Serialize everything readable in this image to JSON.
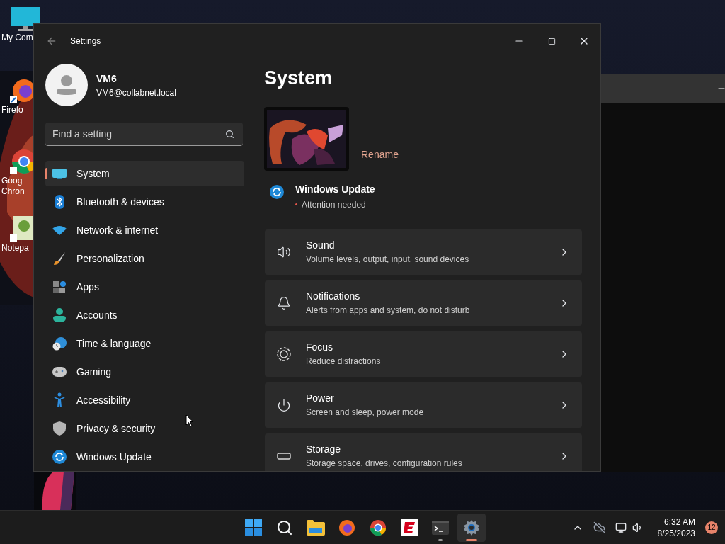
{
  "desktop_icons": [
    {
      "lines": [
        "My Com"
      ]
    },
    {
      "lines": [
        "Firefo"
      ]
    },
    {
      "lines": [
        "Goog",
        "Chron"
      ]
    },
    {
      "lines": [
        "Notepa"
      ]
    }
  ],
  "settings_window": {
    "title": "Settings",
    "user": {
      "name": "VM6",
      "email": "VM6@collabnet.local"
    },
    "search": {
      "placeholder": "Find a setting"
    },
    "nav": [
      {
        "label": "System",
        "selected": true
      },
      {
        "label": "Bluetooth & devices",
        "selected": false
      },
      {
        "label": "Network & internet",
        "selected": false
      },
      {
        "label": "Personalization",
        "selected": false
      },
      {
        "label": "Apps",
        "selected": false
      },
      {
        "label": "Accounts",
        "selected": false
      },
      {
        "label": "Time & language",
        "selected": false
      },
      {
        "label": "Gaming",
        "selected": false
      },
      {
        "label": "Accessibility",
        "selected": false
      },
      {
        "label": "Privacy & security",
        "selected": false
      },
      {
        "label": "Windows Update",
        "selected": false
      }
    ],
    "page": {
      "title": "System",
      "rename": "Rename",
      "update": {
        "title": "Windows Update",
        "status": "Attention needed"
      },
      "cards": [
        {
          "title": "Sound",
          "subtitle": "Volume levels, output, input, sound devices"
        },
        {
          "title": "Notifications",
          "subtitle": "Alerts from apps and system, do not disturb"
        },
        {
          "title": "Focus",
          "subtitle": "Reduce distractions"
        },
        {
          "title": "Power",
          "subtitle": "Screen and sleep, power mode"
        },
        {
          "title": "Storage",
          "subtitle": "Storage space, drives, configuration rules"
        }
      ]
    }
  },
  "taskbar": {
    "apps": [
      {
        "selected": false,
        "running": false
      },
      {
        "selected": false,
        "running": false
      },
      {
        "selected": false,
        "running": false
      },
      {
        "selected": false,
        "running": false
      },
      {
        "selected": false,
        "running": false
      },
      {
        "selected": false,
        "running": false
      },
      {
        "selected": false,
        "running": true
      },
      {
        "selected": true,
        "running": true
      }
    ],
    "time": "6:32 AM",
    "date": "8/25/2023",
    "notifications": "12"
  }
}
